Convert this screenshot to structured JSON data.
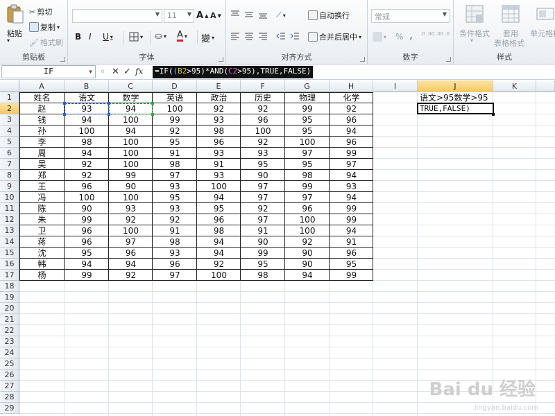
{
  "ribbon": {
    "clipboard": {
      "label": "剪贴板",
      "paste": "粘贴",
      "cut": "剪切",
      "copy": "复制",
      "format_painter": "格式刷"
    },
    "font": {
      "label": "字体",
      "font_name": "",
      "font_size": "11",
      "bold": "B",
      "italic": "I",
      "underline": "U",
      "grow": "A",
      "shrink": "A",
      "pinyin": "變"
    },
    "alignment": {
      "label": "对齐方式",
      "wrap_text": "自动换行",
      "merge_center": "合并后居中"
    },
    "number": {
      "label": "数字",
      "format": "常规",
      "percent": "%",
      "comma": ",",
      "inc_decimal": ".0 .00",
      "dec_decimal": ".00 .0"
    },
    "styles": {
      "label": "样式",
      "conditional": "条件格式",
      "table_format_1": "套用",
      "table_format_2": "表格格式",
      "cell_style": "单元格样"
    }
  },
  "formula_bar": {
    "name_box": "IF",
    "cancel": "✕",
    "enter": "✓",
    "fx": "fx",
    "formula_parts": [
      "=IF(",
      "(",
      "B2",
      ">95)*AND(",
      "C2",
      ">95),TRUE,FALSE)"
    ]
  },
  "columns": [
    "A",
    "B",
    "C",
    "D",
    "E",
    "F",
    "G",
    "H",
    "I",
    "J",
    "K"
  ],
  "rows": [
    "1",
    "2",
    "3",
    "4",
    "5",
    "6",
    "7",
    "8",
    "9",
    "10",
    "11",
    "12",
    "13",
    "14",
    "15",
    "16",
    "17",
    "18",
    "19",
    "20",
    "21",
    "22",
    "23",
    "24",
    "25",
    "26",
    "27",
    "28",
    "29"
  ],
  "table": {
    "headers": [
      "姓名",
      "语文",
      "数学",
      "英语",
      "政治",
      "历史",
      "物理",
      "化学"
    ],
    "data": [
      [
        "赵",
        "93",
        "94",
        "100",
        "92",
        "92",
        "99",
        "92"
      ],
      [
        "钱",
        "94",
        "100",
        "99",
        "93",
        "96",
        "95",
        "96"
      ],
      [
        "孙",
        "100",
        "94",
        "92",
        "98",
        "100",
        "95",
        "94"
      ],
      [
        "李",
        "98",
        "100",
        "95",
        "96",
        "92",
        "100",
        "96"
      ],
      [
        "周",
        "94",
        "100",
        "91",
        "93",
        "93",
        "97",
        "99"
      ],
      [
        "吴",
        "92",
        "100",
        "98",
        "91",
        "95",
        "95",
        "97"
      ],
      [
        "郑",
        "92",
        "99",
        "97",
        "93",
        "90",
        "98",
        "94"
      ],
      [
        "王",
        "96",
        "90",
        "93",
        "100",
        "97",
        "99",
        "93"
      ],
      [
        "冯",
        "100",
        "100",
        "95",
        "94",
        "97",
        "97",
        "94"
      ],
      [
        "陈",
        "90",
        "93",
        "93",
        "95",
        "92",
        "96",
        "99"
      ],
      [
        "朱",
        "99",
        "92",
        "92",
        "96",
        "97",
        "100",
        "99"
      ],
      [
        "卫",
        "96",
        "100",
        "91",
        "98",
        "91",
        "100",
        "94"
      ],
      [
        "蒋",
        "96",
        "97",
        "98",
        "94",
        "90",
        "92",
        "91"
      ],
      [
        "沈",
        "95",
        "96",
        "93",
        "94",
        "99",
        "90",
        "96"
      ],
      [
        "韩",
        "94",
        "94",
        "96",
        "92",
        "95",
        "90",
        "95"
      ],
      [
        "杨",
        "99",
        "92",
        "97",
        "100",
        "98",
        "94",
        "99"
      ]
    ]
  },
  "j_column": {
    "j1": "语文>95数学>95",
    "j2": "TRUE,FALSE)"
  },
  "watermark": {
    "brand": "Bai du 经验",
    "url": "jingyan.baidu.com"
  },
  "colors": {
    "ref_b": "#2d5be0",
    "ref_c": "#2fa83c",
    "selected_header": "#f6c862"
  }
}
